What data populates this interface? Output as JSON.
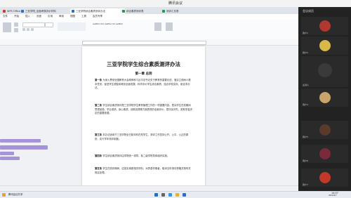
{
  "meeting": {
    "title": "腾讯会议"
  },
  "wps": {
    "tabs": [
      {
        "label": "WPS Office",
        "color": "#d9342b"
      },
      {
        "label": "三亚学院_全面考核评价材料",
        "color": "#2b6ad9"
      },
      {
        "label": "三亚学院综合素质测评办法",
        "color": "#2b6ad9"
      },
      {
        "label": "综合素质测评表",
        "color": "#1a9c4a"
      },
      {
        "label": "测评汇总表",
        "color": "#1a9c4a"
      }
    ],
    "menu": [
      "文件",
      "开始",
      "插入",
      "页面",
      "引用",
      "审阅",
      "视图",
      "工具",
      "会员专享"
    ],
    "font_sample": "AaBbCcDd AaBbCcD AaBbC",
    "document": {
      "title": "三亚学院学生综合素质测评办法",
      "chapter": "第一章 总则",
      "paragraphs": [
        {
          "label": "第一条",
          "text": "为深入贯彻全国教育大会精神和习近平总书记关于教育的重要论述，落实立德树人根本任务，促进学生德智体美劳全面发展，科学评价学生综合素质，结合学校实际，制定本办法。"
        },
        {
          "label": "第二条",
          "text": "学生综合素质测评是三亚学院学生教育管理工作的一项重要内容，是对学生在校期间思想品德、学业成绩、身心素质、创新实践等方面表现的全面评价，是评优评先、奖助学金评定的重要依据。"
        },
        {
          "label": "第三条",
          "text": "本办法适用于三亚学院全日制本科在校学生，测评工作坚持公开、公平、公正的原则，实行学年测评制度。"
        },
        {
          "label": "第四条",
          "text": "学生综合素质测评由学院统一领导，各二级学院具体组织实施。"
        },
        {
          "label": "第五条",
          "text": "学生在测评期间，应如实填报相关材料，对弄虚作假者，取消当年测评资格并按有关规定处理。"
        }
      ]
    }
  },
  "panel": {
    "title": "会议成员",
    "participants": [
      {
        "name": "用户1",
        "color": "#b0392f"
      },
      {
        "name": "用户2",
        "color": "#d9b84a"
      },
      {
        "name": "主讲人",
        "color": "#3a3a3a"
      },
      {
        "name": "用户4",
        "color": "#c8a46a"
      },
      {
        "name": "用户5",
        "color": "#5b3a2a"
      },
      {
        "name": "用户6",
        "color": "#7a2a3a"
      },
      {
        "name": "用户7",
        "color": "#c0392b"
      }
    ]
  },
  "taskbar": {
    "app_label": "腾讯会议共享",
    "time": "14:07",
    "date": "2022/4/7"
  }
}
